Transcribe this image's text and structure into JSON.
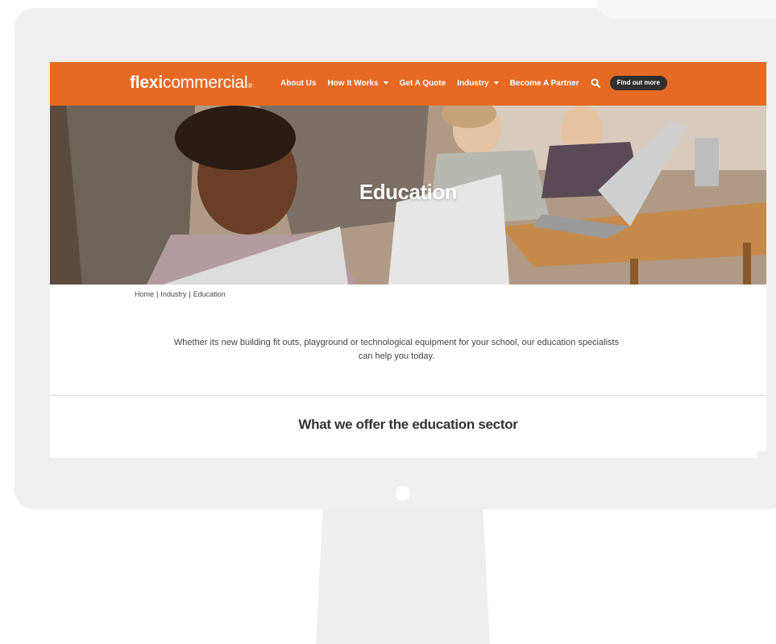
{
  "brand": {
    "logo_bold": "flexi",
    "logo_light": "commercial",
    "logo_mark": "®",
    "accent_color": "#e66a23"
  },
  "nav": {
    "items": [
      {
        "label": "About Us",
        "has_dropdown": false
      },
      {
        "label": "How It Works",
        "has_dropdown": true
      },
      {
        "label": "Get A Quote",
        "has_dropdown": false
      },
      {
        "label": "Industry",
        "has_dropdown": true
      },
      {
        "label": "Become A Partner",
        "has_dropdown": false
      }
    ],
    "search_icon": "search-icon",
    "cta_label": "Find out more"
  },
  "hero": {
    "title": "Education"
  },
  "breadcrumb": {
    "items": [
      "Home",
      "Industry",
      "Education"
    ],
    "separator": "|"
  },
  "intro": {
    "text": "Whether its new building fit outs, playground or technological equipment for your school, our education specialists can help you today."
  },
  "section": {
    "title": "What we offer the education sector"
  }
}
